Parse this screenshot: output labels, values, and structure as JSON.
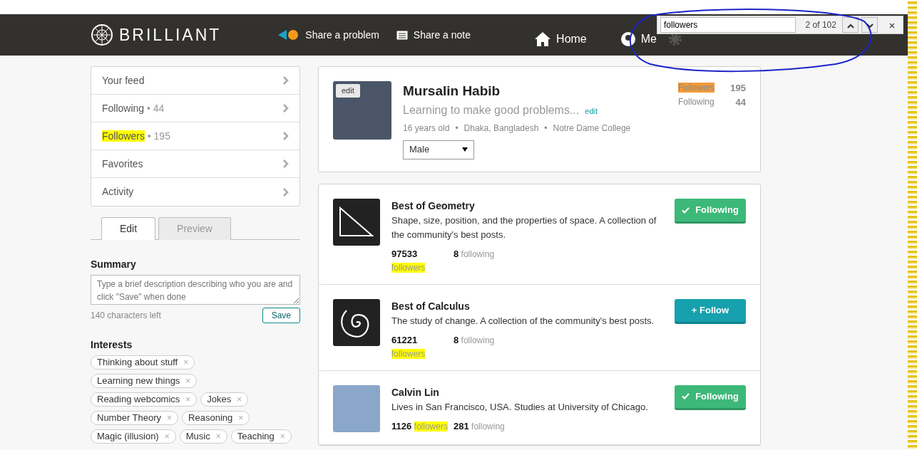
{
  "navbar": {
    "logo": "BRILLIANT",
    "links": [
      {
        "kind": "problem",
        "label": "Share a problem"
      },
      {
        "kind": "note",
        "label": "Share a note"
      },
      {
        "kind": "home",
        "label": "Home"
      },
      {
        "kind": "me",
        "label": "Me"
      },
      {
        "kind": "settings"
      }
    ]
  },
  "find_bar": {
    "value": "followers",
    "count": "2 of 102"
  },
  "sidebar": {
    "separator": "•",
    "items": [
      {
        "label": "Your feed",
        "highlighted": false
      },
      {
        "label": "Following",
        "count": "44",
        "highlighted": false
      },
      {
        "label": "Followers",
        "count": "195",
        "highlighted": true
      },
      {
        "label": "Favorites",
        "highlighted": false
      },
      {
        "label": "Activity",
        "highlighted": false
      }
    ]
  },
  "editor": {
    "tabs": [
      {
        "label": "Edit",
        "selected": true
      },
      {
        "label": "Preview",
        "selected": false
      }
    ],
    "summary_label": "Summary",
    "placeholder": "Type a brief description describing who you are and click \"Save\" when done",
    "chars_left": "140 characters left",
    "save": "Save"
  },
  "interests": {
    "title": "Interests",
    "tags": [
      {
        "label": "Thinking about stuff",
        "remove": "×"
      },
      {
        "label": "Learning new things",
        "remove": "×"
      },
      {
        "label": "Reading webcomics",
        "remove": "×"
      },
      {
        "label": "Jokes",
        "remove": "×"
      },
      {
        "label": "Number Theory",
        "remove": "×"
      },
      {
        "label": "Reasoning",
        "remove": "×"
      },
      {
        "label": "Magic (illusion)",
        "remove": "×"
      },
      {
        "label": "Music",
        "remove": "×"
      },
      {
        "label": "Teaching",
        "remove": "×"
      }
    ]
  },
  "profile": {
    "photo_edit": "edit",
    "name": "Mursalin Habib",
    "tagline": "Learning to make good problems...",
    "tagline_edit": "edit",
    "separator": "•",
    "details": [
      "16 years old",
      "Dhaka, Bangladesh",
      "Notre Dame College"
    ],
    "gender": "Male",
    "stats": [
      {
        "label": "Followers",
        "value": "195",
        "current_match": true
      },
      {
        "label": "Following",
        "value": "44",
        "current_match": false
      }
    ]
  },
  "follow_list": [
    {
      "kind": "triangle",
      "name": "Best of Geometry",
      "description": "Shape, size, position, and the properties of space. A collection of the community's best posts.",
      "followers": "97533",
      "followers_label": "followers",
      "following": "8",
      "following_label": "following",
      "followed": true,
      "button": "Following"
    },
    {
      "kind": "spiral",
      "name": "Best of Calculus",
      "description": "The study of change. A collection of the community's best posts.",
      "followers": "61221",
      "followers_label": "followers",
      "following": "8",
      "following_label": "following",
      "followed": false,
      "button": "+ Follow"
    },
    {
      "kind": "photo",
      "name": "Calvin Lin",
      "description": "Lives in San Francisco, USA. Studies at University of Chicago.",
      "followers": "1126",
      "followers_label": "followers",
      "following": "281",
      "following_label": "following",
      "followed": true,
      "button": "Following"
    }
  ]
}
